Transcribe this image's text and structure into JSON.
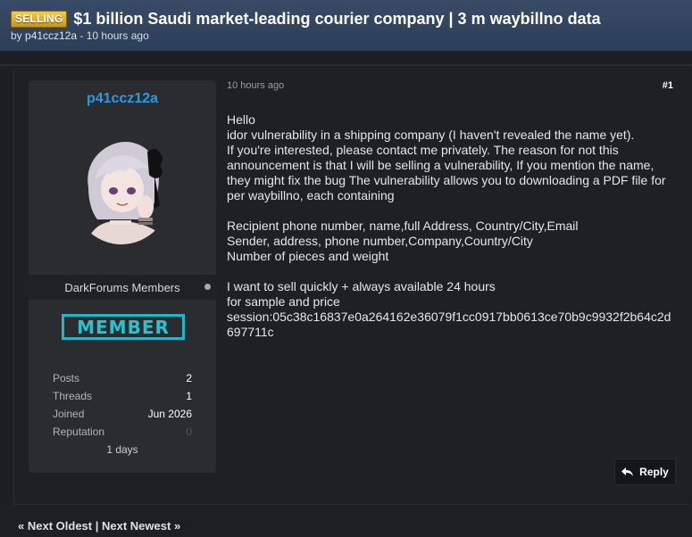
{
  "thread": {
    "prefix": "SELLING",
    "title": "$1 billion Saudi market-leading courier company | 3 m waybillno data",
    "byline_by": "by ",
    "author": "p41ccz12a",
    "byline_time": " - 10 hours ago"
  },
  "author_card": {
    "username": "p41ccz12a",
    "group": "DarkForums Members",
    "rank_badge": "MEMBER",
    "stats": [
      {
        "label": "Posts",
        "value": "2"
      },
      {
        "label": "Threads",
        "value": "1"
      },
      {
        "label": "Joined",
        "value": "Jun 2026"
      },
      {
        "label": "Reputation",
        "value": "0"
      }
    ],
    "extra": "1 days",
    "colors": {
      "username": "#2a9ae8",
      "rank": "#1fb8c8"
    }
  },
  "post": {
    "time": "10 hours ago",
    "number": "#1",
    "lines": [
      "Hello",
      "idor vulnerability in a shipping company (I haven't revealed the name yet).",
      "If you're interested, please contact me privately. The reason for not this announcement is that I will be selling a vulnerability, If you mention the name, they might fix the bug The vulnerability allows you to downloading a PDF file for  per waybillno, each containing",
      "",
      "Recipient phone number, name,full Address, Country/City,Email",
      "Sender, address, phone number,Company,Country/City",
      "Number of pieces and weight",
      "",
      "I want to sell quickly + always available 24 hours",
      "for sample and price",
      "session:05c38c16837e0a264162e36079f1cc0917bb0613ce70b9c9932f2b64c2d697711c"
    ],
    "reply_label": "Reply"
  },
  "nav": {
    "prev_arrow": "«",
    "next_oldest": "Next Oldest",
    "separator": "|",
    "next_newest": "Next Newest",
    "next_arrow": "»"
  }
}
